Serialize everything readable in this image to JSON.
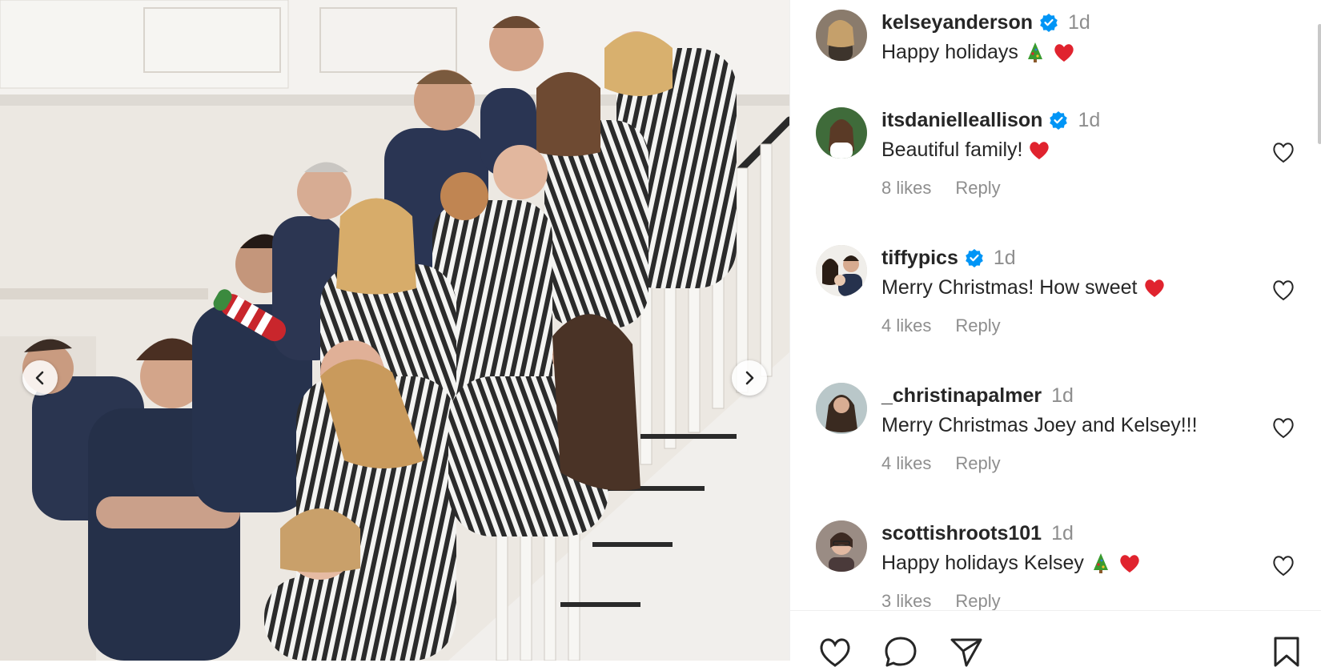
{
  "post": {
    "author": "kelseyanderson",
    "caption": "Happy holidays",
    "time": "1d"
  },
  "comments": [
    {
      "username": "itsdanielleallison",
      "verified": true,
      "time": "1d",
      "text": "Beautiful family!",
      "likes": "8 likes",
      "reply": "Reply"
    },
    {
      "username": "tiffypics",
      "verified": true,
      "time": "1d",
      "text": "Merry Christmas! How sweet",
      "likes": "4 likes",
      "reply": "Reply"
    },
    {
      "username": "_christinapalmer",
      "verified": false,
      "time": "1d",
      "text": "Merry Christmas Joey and Kelsey!!!",
      "likes": "4 likes",
      "reply": "Reply"
    },
    {
      "username": "scottishroots101",
      "verified": false,
      "time": "1d",
      "text": "Happy holidays Kelsey",
      "likes": "3 likes",
      "reply": "Reply"
    }
  ],
  "icons": {
    "verified": "verified-badge-icon",
    "tree": "christmas-tree-emoji",
    "heart": "red-heart-emoji",
    "like": "heart-outline-icon",
    "comment": "comment-icon",
    "share": "send-icon",
    "save": "bookmark-icon",
    "prev": "chevron-left-icon",
    "next": "chevron-right-icon"
  },
  "colors": {
    "verified_blue": "#0095f6",
    "text": "#262626",
    "muted": "#8e8e8e",
    "heart_red": "#e0232e",
    "tree_green": "#3a9b2f"
  }
}
